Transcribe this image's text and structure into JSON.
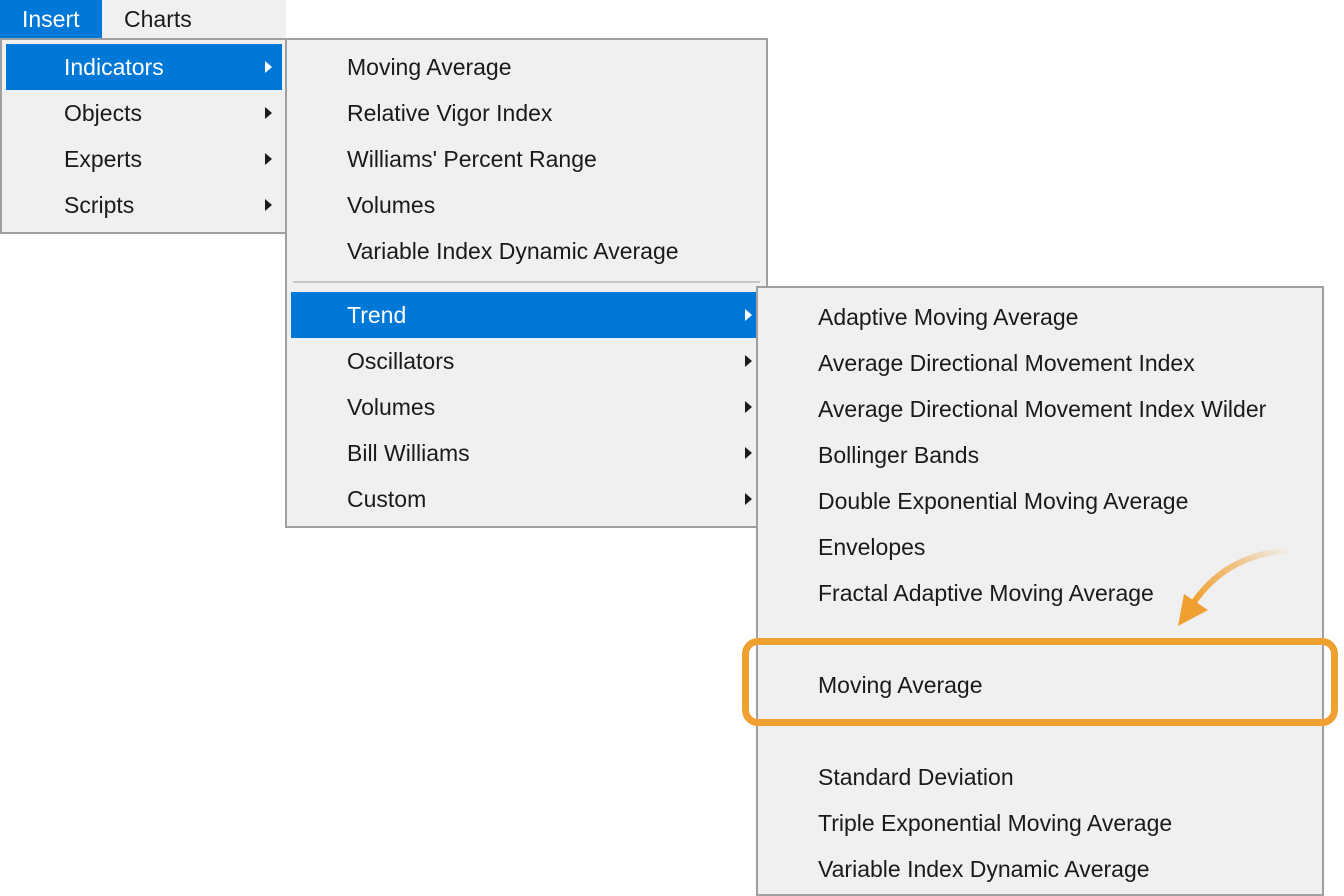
{
  "menubar": {
    "insert": "Insert",
    "charts": "Charts"
  },
  "insert_menu": {
    "items": [
      {
        "label": "Indicators"
      },
      {
        "label": "Objects"
      },
      {
        "label": "Experts"
      },
      {
        "label": "Scripts"
      }
    ]
  },
  "indicators_menu": {
    "quick_items": [
      {
        "label": "Moving Average"
      },
      {
        "label": "Relative Vigor Index"
      },
      {
        "label": "Williams' Percent Range"
      },
      {
        "label": "Volumes"
      },
      {
        "label": "Variable Index Dynamic Average"
      }
    ],
    "categories": [
      {
        "label": "Trend"
      },
      {
        "label": "Oscillators"
      },
      {
        "label": "Volumes"
      },
      {
        "label": "Bill Williams"
      },
      {
        "label": "Custom"
      }
    ]
  },
  "trend_menu": {
    "items": [
      {
        "label": "Adaptive Moving Average"
      },
      {
        "label": "Average Directional Movement Index"
      },
      {
        "label": "Average Directional Movement Index Wilder"
      },
      {
        "label": "Bollinger Bands"
      },
      {
        "label": "Double Exponential Moving Average"
      },
      {
        "label": "Envelopes"
      },
      {
        "label": "Fractal Adaptive Moving Average"
      },
      {
        "label": "Moving Average"
      },
      {
        "label": "Standard Deviation"
      },
      {
        "label": "Triple Exponential Moving Average"
      },
      {
        "label": "Variable Index Dynamic Average"
      }
    ]
  },
  "colors": {
    "selection": "#0078d7",
    "menu_background": "#f0f0f0",
    "callout": "#f0a030"
  }
}
